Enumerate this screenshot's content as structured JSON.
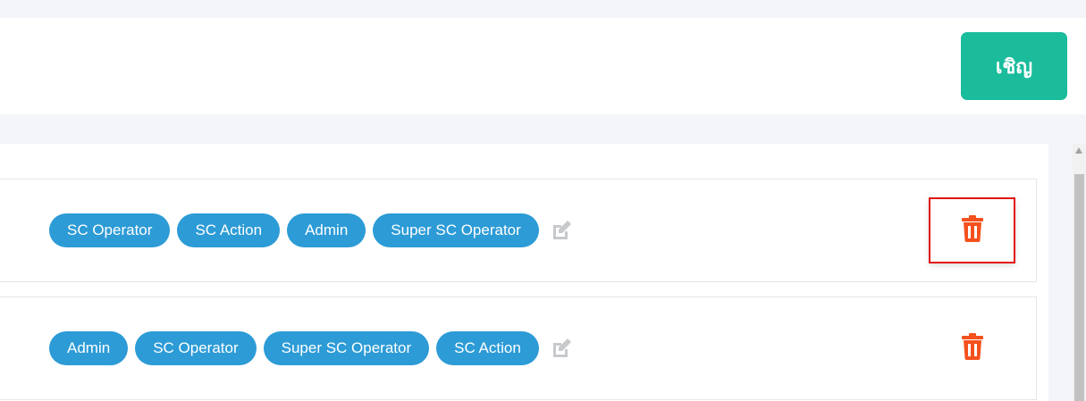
{
  "header": {
    "invite_label": "เชิญ"
  },
  "rows": [
    {
      "roles": [
        "SC Operator",
        "SC Action",
        "Admin",
        "Super SC Operator"
      ],
      "edit_icon": "pencil-square-icon",
      "delete_icon": "trash-icon",
      "delete_highlighted": true
    },
    {
      "roles": [
        "Admin",
        "SC Operator",
        "Super SC Operator",
        "SC Action"
      ],
      "edit_icon": "pencil-square-icon",
      "delete_icon": "trash-icon",
      "delete_highlighted": false
    }
  ],
  "colors": {
    "invite_button": "#1abc9c",
    "tag": "#2c9bd6",
    "delete": "#f4511e",
    "highlight_border": "#e31414",
    "edit_icon": "#c7c9cc"
  }
}
